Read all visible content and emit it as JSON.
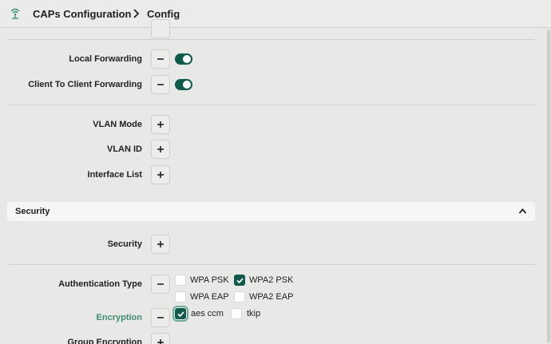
{
  "header": {
    "app_icon": "wifi-antenna-icon",
    "breadcrumb_parent": "CAPs Configuration",
    "breadcrumb_current": "Config"
  },
  "general": {
    "local_forwarding": {
      "label": "Local Forwarding",
      "enabled": true
    },
    "client_to_client": {
      "label": "Client To Client Forwarding",
      "enabled": true
    },
    "vlan_mode": {
      "label": "VLAN Mode"
    },
    "vlan_id": {
      "label": "VLAN ID"
    },
    "interface_list": {
      "label": "Interface List"
    }
  },
  "security_section": {
    "title": "Security",
    "expanded": true,
    "security_field": {
      "label": "Security"
    },
    "authentication_type": {
      "label": "Authentication Type",
      "options": [
        {
          "label": "WPA PSK",
          "checked": false
        },
        {
          "label": "WPA2 PSK",
          "checked": true
        },
        {
          "label": "WPA EAP",
          "checked": false
        },
        {
          "label": "WPA2 EAP",
          "checked": false
        }
      ]
    },
    "encryption": {
      "label": "Encryption",
      "options": [
        {
          "label": "aes ccm",
          "checked": true
        },
        {
          "label": "tkip",
          "checked": false
        }
      ]
    },
    "group_encryption": {
      "label": "Group Encryption"
    }
  },
  "colors": {
    "accent": "#0f5a4b",
    "label_accent": "#3f8f70",
    "background": "#e8e8e6"
  }
}
